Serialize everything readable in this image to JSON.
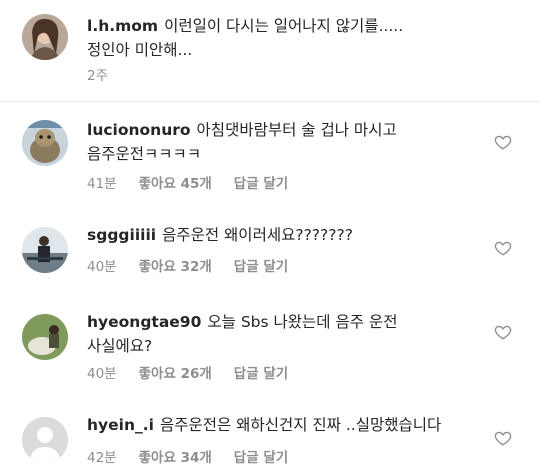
{
  "comments": [
    {
      "username": "l.h.mom",
      "text": "이런일이 다시는 일어나지 않기를.....\n정인아 미안해...",
      "time": "2주",
      "likes": "",
      "reply": ""
    },
    {
      "username": "luciononuro",
      "text": "아침댓바람부터 술 겁나 마시고\n음주운전ㅋㅋㅋㅋ",
      "time": "41분",
      "likes": "좋아요 45개",
      "reply": "답글 달기"
    },
    {
      "username": "sgggiiiii",
      "text": "음주운전 왜이러세요???????",
      "time": "40분",
      "likes": "좋아요 32개",
      "reply": "답글 달기"
    },
    {
      "username": "hyeongtae90",
      "text": "오늘 Sbs 나왔는데 음주 운전\n사실에요?",
      "time": "40분",
      "likes": "좋아요 26개",
      "reply": "답글 달기"
    },
    {
      "username": "hyein_.i",
      "text": "음주운전은 왜하신건지 진짜 ..실망했습니다",
      "time": "42분",
      "likes": "좋아요 34개",
      "reply": "답글 달기"
    }
  ],
  "colors": {
    "text": "#262626",
    "meta": "#8e8e8e",
    "divider": "#efefef"
  }
}
